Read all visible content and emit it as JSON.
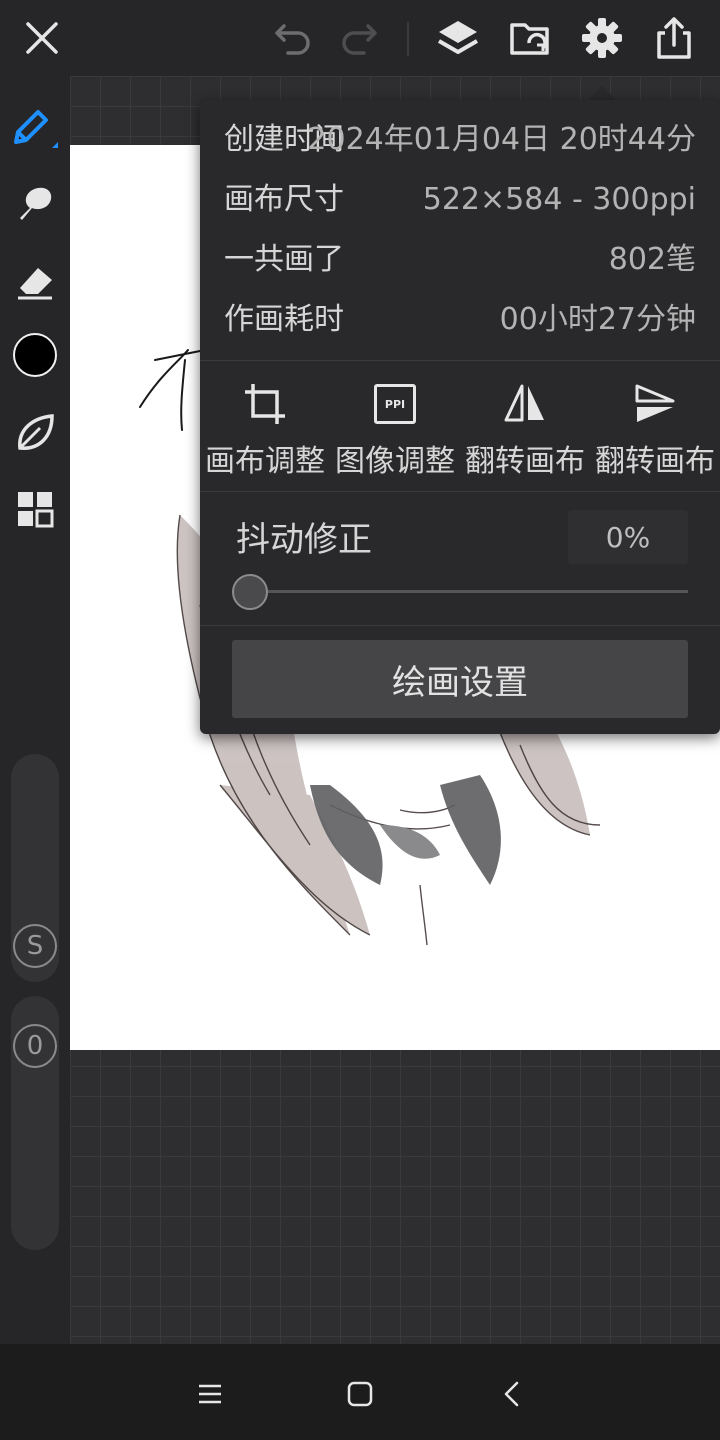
{
  "topbar": {
    "close_icon": "close-icon",
    "undo_icon": "undo-icon",
    "redo_icon": "redo-icon",
    "layers_icon": "layers-icon",
    "gallery_icon": "gallery-icon",
    "settings_icon": "gear-icon",
    "share_icon": "share-icon"
  },
  "toolbar": {
    "tools": [
      "pen-icon",
      "smudge-icon",
      "eraser-icon",
      "color-swatch",
      "leaf-icon",
      "grid-icon"
    ],
    "color": "#000000",
    "accent": "#1e90ff",
    "s_label": "S",
    "zero_label": "0"
  },
  "info": {
    "created_label": "创建时间",
    "created_value": "2024年01月04日 20时44分",
    "size_label": "画布尺寸",
    "size_value": "522×584 - 300ppi",
    "strokes_label": "一共画了",
    "strokes_value": "802笔",
    "time_label": "作画耗时",
    "time_value": "00小时27分钟"
  },
  "tools": {
    "crop_label": "画布调整",
    "ppi_label": "图像调整",
    "ppi_icon_text": "PPI",
    "flip_h_label": "翻转画布",
    "flip_v_label": "翻转画布"
  },
  "stabilizer": {
    "label": "抖动修正",
    "value": "0%",
    "level": 0
  },
  "settings_button": "绘画设置"
}
